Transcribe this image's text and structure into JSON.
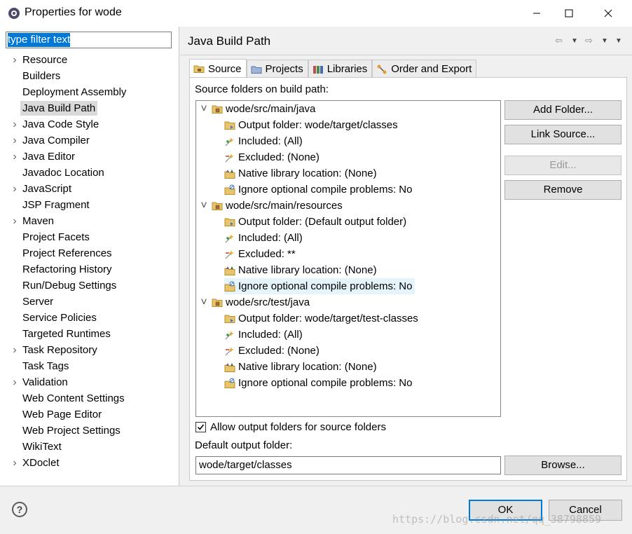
{
  "window": {
    "title": "Properties for wode"
  },
  "filter": {
    "text": "type filter text"
  },
  "nav": [
    {
      "label": "Resource",
      "expandable": true
    },
    {
      "label": "Builders",
      "expandable": false
    },
    {
      "label": "Deployment Assembly",
      "expandable": false
    },
    {
      "label": "Java Build Path",
      "expandable": false,
      "selected": true
    },
    {
      "label": "Java Code Style",
      "expandable": true
    },
    {
      "label": "Java Compiler",
      "expandable": true
    },
    {
      "label": "Java Editor",
      "expandable": true
    },
    {
      "label": "Javadoc Location",
      "expandable": false
    },
    {
      "label": "JavaScript",
      "expandable": true
    },
    {
      "label": "JSP Fragment",
      "expandable": false
    },
    {
      "label": "Maven",
      "expandable": true
    },
    {
      "label": "Project Facets",
      "expandable": false
    },
    {
      "label": "Project References",
      "expandable": false
    },
    {
      "label": "Refactoring History",
      "expandable": false
    },
    {
      "label": "Run/Debug Settings",
      "expandable": false
    },
    {
      "label": "Server",
      "expandable": false
    },
    {
      "label": "Service Policies",
      "expandable": false
    },
    {
      "label": "Targeted Runtimes",
      "expandable": false
    },
    {
      "label": "Task Repository",
      "expandable": true
    },
    {
      "label": "Task Tags",
      "expandable": false
    },
    {
      "label": "Validation",
      "expandable": true
    },
    {
      "label": "Web Content Settings",
      "expandable": false
    },
    {
      "label": "Web Page Editor",
      "expandable": false
    },
    {
      "label": "Web Project Settings",
      "expandable": false
    },
    {
      "label": "WikiText",
      "expandable": false
    },
    {
      "label": "XDoclet",
      "expandable": true
    }
  ],
  "page": {
    "title": "Java Build Path",
    "tabs": [
      {
        "label": "Source",
        "icon": "source-folder-icon",
        "active": true
      },
      {
        "label": "Projects",
        "icon": "projects-icon",
        "active": false
      },
      {
        "label": "Libraries",
        "icon": "libraries-icon",
        "active": false
      },
      {
        "label": "Order and Export",
        "icon": "order-export-icon",
        "active": false
      }
    ],
    "source_label": "Source folders on build path:",
    "tree": [
      {
        "label": "wode/src/main/java",
        "level": 0,
        "icon": "package-folder-icon"
      },
      {
        "label": "Output folder: wode/target/classes",
        "level": 1,
        "icon": "output-folder-icon"
      },
      {
        "label": "Included: (All)",
        "level": 1,
        "icon": "inclusion-filter-icon"
      },
      {
        "label": "Excluded: (None)",
        "level": 1,
        "icon": "exclusion-filter-icon"
      },
      {
        "label": "Native library location: (None)",
        "level": 1,
        "icon": "native-library-icon"
      },
      {
        "label": "Ignore optional compile problems: No",
        "level": 1,
        "icon": "ignore-problems-icon"
      },
      {
        "label": "wode/src/main/resources",
        "level": 0,
        "icon": "package-folder-icon"
      },
      {
        "label": "Output folder: (Default output folder)",
        "level": 1,
        "icon": "output-folder-icon"
      },
      {
        "label": "Included: (All)",
        "level": 1,
        "icon": "inclusion-filter-icon"
      },
      {
        "label": "Excluded: **",
        "level": 1,
        "icon": "exclusion-filter-icon"
      },
      {
        "label": "Native library location: (None)",
        "level": 1,
        "icon": "native-library-icon"
      },
      {
        "label": "Ignore optional compile problems: No",
        "level": 1,
        "icon": "ignore-problems-icon",
        "highlighted": true
      },
      {
        "label": "wode/src/test/java",
        "level": 0,
        "icon": "package-folder-icon"
      },
      {
        "label": "Output folder: wode/target/test-classes",
        "level": 1,
        "icon": "output-folder-icon"
      },
      {
        "label": "Included: (All)",
        "level": 1,
        "icon": "inclusion-filter-icon"
      },
      {
        "label": "Excluded: (None)",
        "level": 1,
        "icon": "exclusion-filter-icon"
      },
      {
        "label": "Native library location: (None)",
        "level": 1,
        "icon": "native-library-icon"
      },
      {
        "label": "Ignore optional compile problems: No",
        "level": 1,
        "icon": "ignore-problems-icon"
      }
    ],
    "buttons": {
      "add_folder": "Add Folder...",
      "link_source": "Link Source...",
      "edit": "Edit...",
      "remove": "Remove",
      "browse": "Browse..."
    },
    "allow_output": {
      "label": "Allow output folders for source folders",
      "checked": true
    },
    "default_output_label": "Default output folder:",
    "default_output_value": "wode/target/classes"
  },
  "footer": {
    "ok": "OK",
    "cancel": "Cancel",
    "help": "?"
  },
  "watermark": "https://blog.csdn.net/qq_38798859",
  "colors": {
    "accent": "#0078d7",
    "selection": "#dadada",
    "tree_highlight": "#e5f3fb"
  }
}
